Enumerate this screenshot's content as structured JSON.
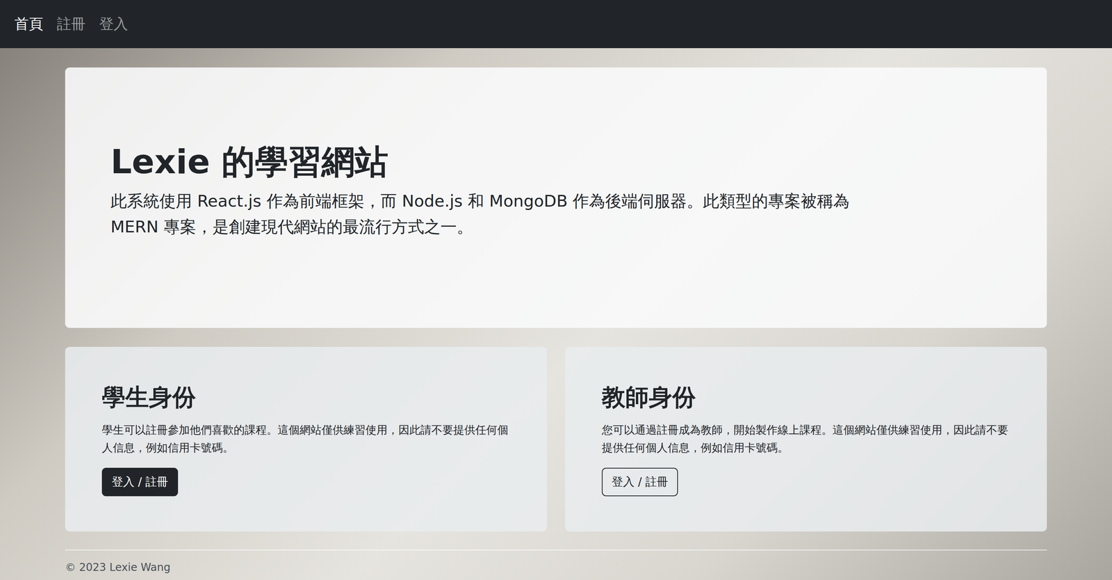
{
  "nav": {
    "items": [
      {
        "label": "首頁",
        "selected": true
      },
      {
        "label": "註冊",
        "selected": false
      },
      {
        "label": "登入",
        "selected": false
      }
    ]
  },
  "hero": {
    "title": "Lexie 的學習網站",
    "text": "此系統使用 React.js 作為前端框架，而 Node.js 和 MongoDB 作為後端伺服器。此類型的專案被稱為 MERN 專案，是創建現代網站的最流行方式之一。"
  },
  "cards": [
    {
      "title": "學生身份",
      "text": "學生可以註冊參加他們喜歡的課程。這個網站僅供練習使用，因此請不要提供任何個人信息，例如信用卡號碼。",
      "button": "登入 / 註冊",
      "kind": "dark"
    },
    {
      "title": "教師身份",
      "text": "您可以通過註冊成為教師，開始製作線上課程。這個網站僅供練習使用，因此請不要提供任何個人信息，例如信用卡號碼。",
      "button": "登入 / 註冊",
      "kind": "outline"
    }
  ],
  "footer": {
    "text": "© 2023 Lexie Wang"
  }
}
